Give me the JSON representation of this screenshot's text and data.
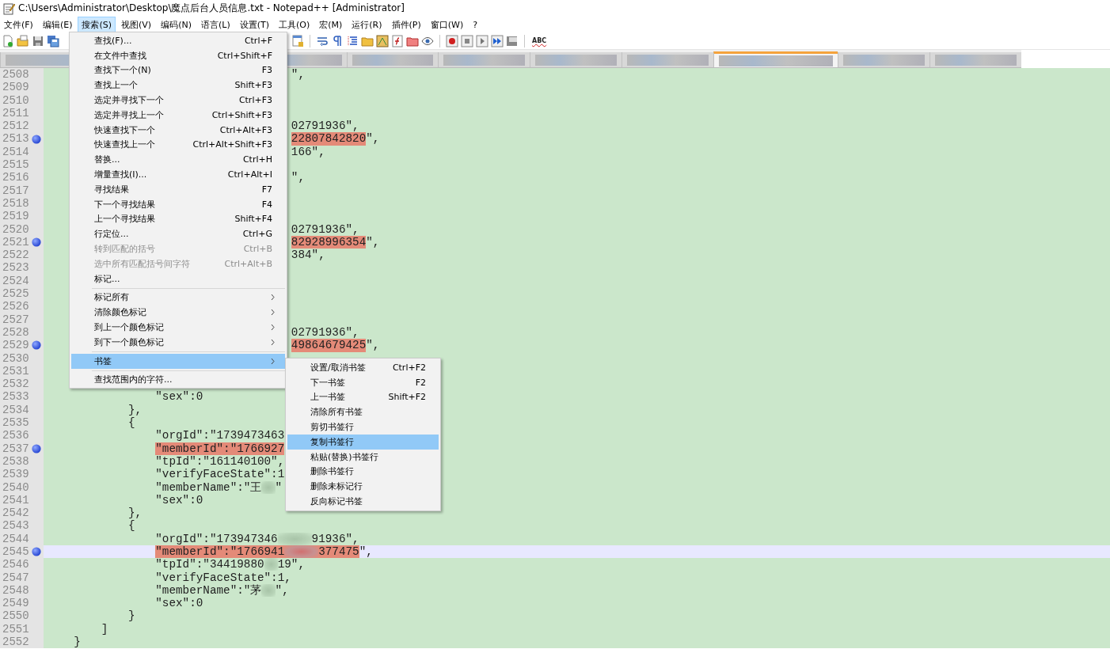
{
  "window": {
    "title": "C:\\Users\\Administrator\\Desktop\\魔点后台人员信息.txt - Notepad++ [Administrator]"
  },
  "menubar": [
    {
      "label": "文件(F)",
      "selected": false
    },
    {
      "label": "编辑(E)",
      "selected": false
    },
    {
      "label": "搜索(S)",
      "selected": true
    },
    {
      "label": "视图(V)",
      "selected": false
    },
    {
      "label": "编码(N)",
      "selected": false
    },
    {
      "label": "语言(L)",
      "selected": false
    },
    {
      "label": "设置(T)",
      "selected": false
    },
    {
      "label": "工具(O)",
      "selected": false
    },
    {
      "label": "宏(M)",
      "selected": false
    },
    {
      "label": "运行(R)",
      "selected": false
    },
    {
      "label": "插件(P)",
      "selected": false
    },
    {
      "label": "窗口(W)",
      "selected": false
    },
    {
      "label": "?",
      "selected": false
    }
  ],
  "toolbar": {
    "spellcheck_label": "ABC"
  },
  "tabs": [
    {
      "selected": false
    },
    {
      "selected": false
    },
    {
      "selected": false
    },
    {
      "selected": false
    },
    {
      "selected": false
    },
    {
      "selected": false
    },
    {
      "selected": true
    },
    {
      "selected": false
    },
    {
      "selected": false
    }
  ],
  "editor": {
    "lines": [
      {
        "number": "2508",
        "bookmark": false,
        "current": false,
        "kind": "clipped",
        "segments": [
          {
            "kind": "text",
            "text": "\","
          }
        ]
      },
      {
        "number": "2509",
        "bookmark": false,
        "current": false,
        "kind": "blank"
      },
      {
        "number": "2510",
        "bookmark": false,
        "current": false,
        "kind": "blank"
      },
      {
        "number": "2511",
        "bookmark": false,
        "current": false,
        "kind": "blank"
      },
      {
        "number": "2512",
        "bookmark": false,
        "current": false,
        "kind": "clipped",
        "segments": [
          {
            "kind": "text",
            "text": "02791936\","
          }
        ]
      },
      {
        "number": "2513",
        "bookmark": true,
        "current": false,
        "kind": "clipped",
        "segments": [
          {
            "kind": "mark",
            "text": "22807842820"
          },
          {
            "kind": "text",
            "text": "\","
          }
        ]
      },
      {
        "number": "2514",
        "bookmark": false,
        "current": false,
        "kind": "clipped",
        "segments": [
          {
            "kind": "text",
            "text": "166\","
          }
        ]
      },
      {
        "number": "2515",
        "bookmark": false,
        "current": false,
        "kind": "blank"
      },
      {
        "number": "2516",
        "bookmark": false,
        "current": false,
        "kind": "clipped",
        "segments": [
          {
            "kind": "text",
            "text": "\","
          }
        ]
      },
      {
        "number": "2517",
        "bookmark": false,
        "current": false,
        "kind": "blank"
      },
      {
        "number": "2518",
        "bookmark": false,
        "current": false,
        "kind": "blank"
      },
      {
        "number": "2519",
        "bookmark": false,
        "current": false,
        "kind": "blank"
      },
      {
        "number": "2520",
        "bookmark": false,
        "current": false,
        "kind": "clipped",
        "segments": [
          {
            "kind": "text",
            "text": "02791936\","
          }
        ]
      },
      {
        "number": "2521",
        "bookmark": true,
        "current": false,
        "kind": "clipped",
        "segments": [
          {
            "kind": "mark",
            "text": "82928996354"
          },
          {
            "kind": "text",
            "text": "\","
          }
        ]
      },
      {
        "number": "2522",
        "bookmark": false,
        "current": false,
        "kind": "clipped",
        "segments": [
          {
            "kind": "text",
            "text": "384\","
          }
        ]
      },
      {
        "number": "2523",
        "bookmark": false,
        "current": false,
        "kind": "blank"
      },
      {
        "number": "2524",
        "bookmark": false,
        "current": false,
        "kind": "blank"
      },
      {
        "number": "2525",
        "bookmark": false,
        "current": false,
        "kind": "blank"
      },
      {
        "number": "2526",
        "bookmark": false,
        "current": false,
        "kind": "blank"
      },
      {
        "number": "2527",
        "bookmark": false,
        "current": false,
        "kind": "blank"
      },
      {
        "number": "2528",
        "bookmark": false,
        "current": false,
        "kind": "clipped",
        "segments": [
          {
            "kind": "text",
            "text": "02791936\","
          }
        ]
      },
      {
        "number": "2529",
        "bookmark": true,
        "current": false,
        "kind": "clipped",
        "segments": [
          {
            "kind": "mark",
            "text": "49864679425"
          },
          {
            "kind": "text",
            "text": "\","
          }
        ]
      },
      {
        "number": "2530",
        "bookmark": false,
        "current": false,
        "kind": "blank"
      },
      {
        "number": "2531",
        "bookmark": false,
        "current": false,
        "kind": "blank"
      },
      {
        "number": "2532",
        "bookmark": false,
        "current": false,
        "kind": "blank"
      },
      {
        "number": "2533",
        "bookmark": false,
        "current": false,
        "kind": "field",
        "segments": [
          {
            "kind": "text",
            "text": "\"sex\":0"
          }
        ]
      },
      {
        "number": "2534",
        "bookmark": false,
        "current": false,
        "kind": "item",
        "segments": [
          {
            "kind": "text",
            "text": "},"
          }
        ]
      },
      {
        "number": "2535",
        "bookmark": false,
        "current": false,
        "kind": "item",
        "segments": [
          {
            "kind": "text",
            "text": "{"
          }
        ]
      },
      {
        "number": "2536",
        "bookmark": false,
        "current": false,
        "kind": "field",
        "segments": [
          {
            "kind": "text",
            "text": "\"orgId\":\"1739473463"
          }
        ]
      },
      {
        "number": "2537",
        "bookmark": true,
        "current": false,
        "kind": "field",
        "segments": [
          {
            "kind": "mark",
            "text": "\"memberId\":\"1766927"
          }
        ]
      },
      {
        "number": "2538",
        "bookmark": false,
        "current": false,
        "kind": "field",
        "segments": [
          {
            "kind": "text",
            "text": "\"tpId\":\"161140100\","
          }
        ]
      },
      {
        "number": "2539",
        "bookmark": false,
        "current": false,
        "kind": "field",
        "segments": [
          {
            "kind": "text",
            "text": "\"verifyFaceState\":1"
          }
        ]
      },
      {
        "number": "2540",
        "bookmark": false,
        "current": false,
        "kind": "field",
        "segments": [
          {
            "kind": "text",
            "text": "\"memberName\":\"王"
          },
          {
            "kind": "blur"
          },
          {
            "kind": "text",
            "text": "\""
          }
        ]
      },
      {
        "number": "2541",
        "bookmark": false,
        "current": false,
        "kind": "field",
        "segments": [
          {
            "kind": "text",
            "text": "\"sex\":0"
          }
        ]
      },
      {
        "number": "2542",
        "bookmark": false,
        "current": false,
        "kind": "item",
        "segments": [
          {
            "kind": "text",
            "text": "},"
          }
        ]
      },
      {
        "number": "2543",
        "bookmark": false,
        "current": false,
        "kind": "item",
        "segments": [
          {
            "kind": "text",
            "text": "{"
          }
        ]
      },
      {
        "number": "2544",
        "bookmark": false,
        "current": false,
        "kind": "field",
        "segments": [
          {
            "kind": "text",
            "text": "\"orgId\":\"173947346"
          },
          {
            "kind": "wide-blur"
          },
          {
            "kind": "text",
            "text": "91936\","
          }
        ]
      },
      {
        "number": "2545",
        "bookmark": true,
        "current": true,
        "kind": "field",
        "segments": [
          {
            "kind": "mark",
            "text": "\"memberId\":\"1766941"
          },
          {
            "kind": "mark-blur"
          },
          {
            "kind": "mark",
            "text": "377475"
          },
          {
            "kind": "text",
            "text": "\","
          }
        ]
      },
      {
        "number": "2546",
        "bookmark": false,
        "current": false,
        "kind": "field",
        "segments": [
          {
            "kind": "text",
            "text": "\"tpId\":\"34419880"
          },
          {
            "kind": "blur"
          },
          {
            "kind": "text",
            "text": "19\","
          }
        ]
      },
      {
        "number": "2547",
        "bookmark": false,
        "current": false,
        "kind": "field",
        "segments": [
          {
            "kind": "text",
            "text": "\"verifyFaceState\":1,"
          }
        ]
      },
      {
        "number": "2548",
        "bookmark": false,
        "current": false,
        "kind": "field",
        "segments": [
          {
            "kind": "text",
            "text": "\"memberName\":\"茅"
          },
          {
            "kind": "blur"
          },
          {
            "kind": "text",
            "text": "\","
          }
        ]
      },
      {
        "number": "2549",
        "bookmark": false,
        "current": false,
        "kind": "field",
        "segments": [
          {
            "kind": "text",
            "text": "\"sex\":0"
          }
        ]
      },
      {
        "number": "2550",
        "bookmark": false,
        "current": false,
        "kind": "item",
        "segments": [
          {
            "kind": "text",
            "text": "}"
          }
        ]
      },
      {
        "number": "2551",
        "bookmark": false,
        "current": false,
        "kind": "array",
        "segments": [
          {
            "kind": "text",
            "text": "]"
          }
        ]
      },
      {
        "number": "2552",
        "bookmark": false,
        "current": false,
        "kind": "object",
        "segments": [
          {
            "kind": "text",
            "text": "}"
          }
        ]
      }
    ]
  },
  "search_menu": {
    "items": [
      {
        "kind": "item",
        "label": "查找(F)...",
        "shortcut": "Ctrl+F",
        "disabled": false,
        "has_submenu": false,
        "selected": false
      },
      {
        "kind": "item",
        "label": "在文件中查找",
        "shortcut": "Ctrl+Shift+F",
        "disabled": false,
        "has_submenu": false,
        "selected": false
      },
      {
        "kind": "item",
        "label": "查找下一个(N)",
        "shortcut": "F3",
        "disabled": false,
        "has_submenu": false,
        "selected": false
      },
      {
        "kind": "item",
        "label": "查找上一个",
        "shortcut": "Shift+F3",
        "disabled": false,
        "has_submenu": false,
        "selected": false
      },
      {
        "kind": "item",
        "label": "选定并寻找下一个",
        "shortcut": "Ctrl+F3",
        "disabled": false,
        "has_submenu": false,
        "selected": false
      },
      {
        "kind": "item",
        "label": "选定并寻找上一个",
        "shortcut": "Ctrl+Shift+F3",
        "disabled": false,
        "has_submenu": false,
        "selected": false
      },
      {
        "kind": "item",
        "label": "快速查找下一个",
        "shortcut": "Ctrl+Alt+F3",
        "disabled": false,
        "has_submenu": false,
        "selected": false
      },
      {
        "kind": "item",
        "label": "快速查找上一个",
        "shortcut": "Ctrl+Alt+Shift+F3",
        "disabled": false,
        "has_submenu": false,
        "selected": false
      },
      {
        "kind": "item",
        "label": "替换...",
        "shortcut": "Ctrl+H",
        "disabled": false,
        "has_submenu": false,
        "selected": false
      },
      {
        "kind": "item",
        "label": "增量查找(I)...",
        "shortcut": "Ctrl+Alt+I",
        "disabled": false,
        "has_submenu": false,
        "selected": false
      },
      {
        "kind": "item",
        "label": "寻找结果",
        "shortcut": "F7",
        "disabled": false,
        "has_submenu": false,
        "selected": false
      },
      {
        "kind": "item",
        "label": "下一个寻找结果",
        "shortcut": "F4",
        "disabled": false,
        "has_submenu": false,
        "selected": false
      },
      {
        "kind": "item",
        "label": "上一个寻找结果",
        "shortcut": "Shift+F4",
        "disabled": false,
        "has_submenu": false,
        "selected": false
      },
      {
        "kind": "item",
        "label": "行定位...",
        "shortcut": "Ctrl+G",
        "disabled": false,
        "has_submenu": false,
        "selected": false
      },
      {
        "kind": "item",
        "label": "转到匹配的括号",
        "shortcut": "Ctrl+B",
        "disabled": true,
        "has_submenu": false,
        "selected": false
      },
      {
        "kind": "item",
        "label": "选中所有匹配括号间字符",
        "shortcut": "Ctrl+Alt+B",
        "disabled": true,
        "has_submenu": false,
        "selected": false
      },
      {
        "kind": "item",
        "label": "标记...",
        "disabled": false,
        "has_submenu": false,
        "selected": false
      },
      {
        "kind": "separator"
      },
      {
        "kind": "item",
        "label": "标记所有",
        "disabled": false,
        "has_submenu": true,
        "selected": false
      },
      {
        "kind": "item",
        "label": "清除颜色标记",
        "disabled": false,
        "has_submenu": true,
        "selected": false
      },
      {
        "kind": "item",
        "label": "到上一个颜色标记",
        "disabled": false,
        "has_submenu": true,
        "selected": false
      },
      {
        "kind": "item",
        "label": "到下一个颜色标记",
        "disabled": false,
        "has_submenu": true,
        "selected": false
      },
      {
        "kind": "separator"
      },
      {
        "kind": "item",
        "label": "书签",
        "disabled": false,
        "has_submenu": true,
        "selected": true
      },
      {
        "kind": "separator"
      },
      {
        "kind": "item",
        "label": "查找范围内的字符...",
        "disabled": false,
        "has_submenu": false,
        "selected": false
      }
    ]
  },
  "bookmark_submenu": {
    "items": [
      {
        "kind": "item",
        "label": "设置/取消书签",
        "shortcut": "Ctrl+F2",
        "disabled": false,
        "has_submenu": false,
        "selected": false
      },
      {
        "kind": "item",
        "label": "下一书签",
        "shortcut": "F2",
        "disabled": false,
        "has_submenu": false,
        "selected": false
      },
      {
        "kind": "item",
        "label": "上一书签",
        "shortcut": "Shift+F2",
        "disabled": false,
        "has_submenu": false,
        "selected": false
      },
      {
        "kind": "item",
        "label": "清除所有书签",
        "disabled": false,
        "has_submenu": false,
        "selected": false
      },
      {
        "kind": "item",
        "label": "剪切书签行",
        "disabled": false,
        "has_submenu": false,
        "selected": false
      },
      {
        "kind": "item",
        "label": "复制书签行",
        "disabled": false,
        "has_submenu": false,
        "selected": true
      },
      {
        "kind": "item",
        "label": "粘贴(替换)书签行",
        "disabled": false,
        "has_submenu": false,
        "selected": false
      },
      {
        "kind": "item",
        "label": "删除书签行",
        "disabled": false,
        "has_submenu": false,
        "selected": false
      },
      {
        "kind": "item",
        "label": "删除未标记行",
        "disabled": false,
        "has_submenu": false,
        "selected": false
      },
      {
        "kind": "item",
        "label": "反向标记书签",
        "disabled": false,
        "has_submenu": false,
        "selected": false
      }
    ]
  }
}
